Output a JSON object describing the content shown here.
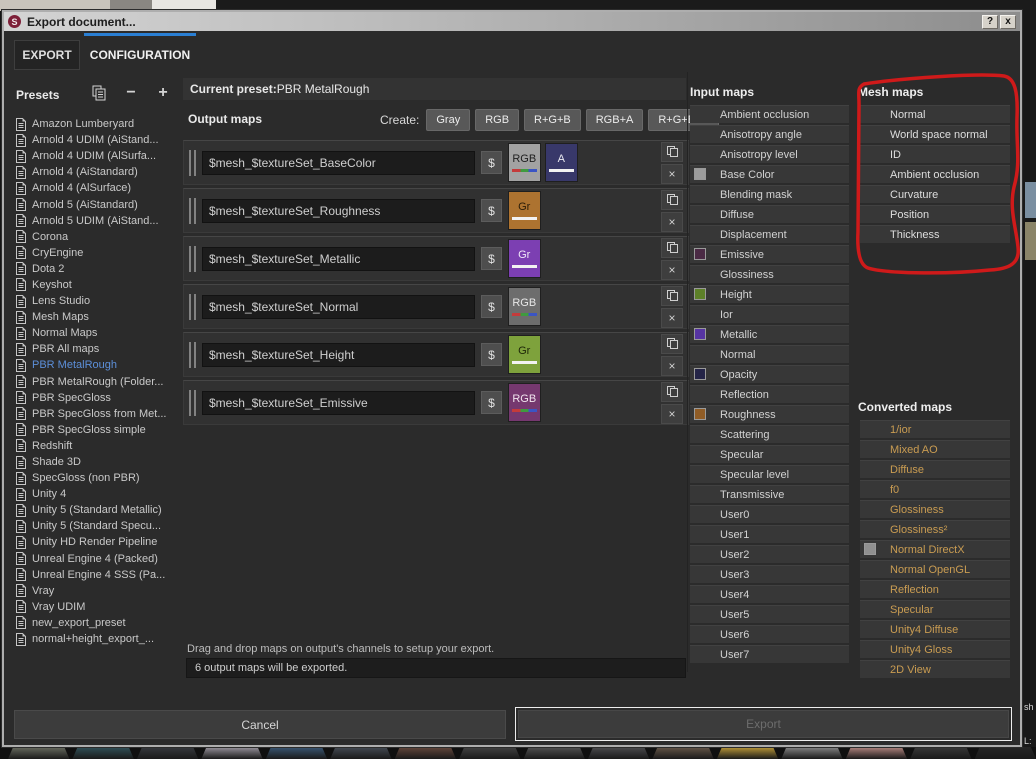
{
  "window": {
    "title": "Export document...",
    "help_label": "?",
    "close_label": "x"
  },
  "tabs": {
    "export": "EXPORT",
    "configuration": "CONFIGURATION"
  },
  "presets": {
    "title": "Presets",
    "selected": "PBR MetalRough",
    "items": [
      "Amazon Lumberyard",
      "Arnold 4 UDIM (AiStand...",
      "Arnold 4 UDIM (AlSurfa...",
      "Arnold 4 (AiStandard)",
      "Arnold 4 (AlSurface)",
      "Arnold 5 (AiStandard)",
      "Arnold 5 UDIM (AiStand...",
      "Corona",
      "CryEngine",
      "Dota 2",
      "Keyshot",
      "Lens Studio",
      "Mesh Maps",
      "Normal Maps",
      "PBR All maps",
      "PBR MetalRough",
      "PBR MetalRough (Folder...",
      "PBR SpecGloss",
      "PBR SpecGloss from Met...",
      "PBR SpecGloss simple",
      "Redshift",
      "Shade 3D",
      "SpecGloss (non PBR)",
      "Unity 4",
      "Unity 5 (Standard Metallic)",
      "Unity 5 (Standard Specu...",
      "Unity HD Render Pipeline",
      "Unreal Engine 4 (Packed)",
      "Unreal Engine 4 SSS (Pa...",
      "Vray",
      "Vray UDIM",
      "new_export_preset",
      "normal+height_export_..."
    ]
  },
  "current_preset": {
    "label": "Current preset:",
    "value": "PBR MetalRough"
  },
  "output_maps": {
    "title": "Output maps",
    "create_label": "Create:",
    "create_buttons": [
      "Gray",
      "RGB",
      "R+G+B",
      "RGB+A",
      "R+G+B+A"
    ],
    "dollar_label": "$",
    "remove_label": "×",
    "rows": [
      {
        "name": "$mesh_$textureSet_BaseColor",
        "chips": [
          {
            "label": "RGB",
            "bg": "#a2a2a2",
            "fg": "#1e1e1e",
            "line": "rgb"
          },
          {
            "label": "A",
            "bg": "#38386a",
            "fg": "#e8e8f0",
            "line": "white"
          }
        ]
      },
      {
        "name": "$mesh_$textureSet_Roughness",
        "chips": [
          {
            "label": "Gr",
            "bg": "#ad7330",
            "fg": "#2a1c08",
            "line": "white"
          }
        ]
      },
      {
        "name": "$mesh_$textureSet_Metallic",
        "chips": [
          {
            "label": "Gr",
            "bg": "#7c3fb2",
            "fg": "#f0e8f8",
            "line": "white"
          }
        ]
      },
      {
        "name": "$mesh_$textureSet_Normal",
        "chips": [
          {
            "label": "RGB",
            "bg": "#6d6d6d",
            "fg": "#e8e8e8",
            "line": "rgb"
          }
        ]
      },
      {
        "name": "$mesh_$textureSet_Height",
        "chips": [
          {
            "label": "Gr",
            "bg": "#7ea23c",
            "fg": "#1d2608",
            "line": "white"
          }
        ]
      },
      {
        "name": "$mesh_$textureSet_Emissive",
        "chips": [
          {
            "label": "RGB",
            "bg": "#75386f",
            "fg": "#f0e4ee",
            "line": "rgb"
          }
        ]
      }
    ],
    "hint": "Drag and drop maps on output's channels to setup your export.",
    "status": "6 output maps will be exported."
  },
  "input_maps": {
    "title": "Input maps",
    "items": [
      {
        "label": "Ambient occlusion"
      },
      {
        "label": "Anisotropy angle"
      },
      {
        "label": "Anisotropy level"
      },
      {
        "label": "Base Color",
        "swatch": "#9c9c9c"
      },
      {
        "label": "Blending mask"
      },
      {
        "label": "Diffuse"
      },
      {
        "label": "Displacement"
      },
      {
        "label": "Emissive",
        "swatch": "#4a2a44"
      },
      {
        "label": "Glossiness"
      },
      {
        "label": "Height",
        "swatch": "#5d8029"
      },
      {
        "label": "Ior"
      },
      {
        "label": "Metallic",
        "swatch": "#5634a2"
      },
      {
        "label": "Normal"
      },
      {
        "label": "Opacity",
        "swatch": "#242447"
      },
      {
        "label": "Reflection"
      },
      {
        "label": "Roughness",
        "swatch": "#8f5c26"
      },
      {
        "label": "Scattering"
      },
      {
        "label": "Specular"
      },
      {
        "label": "Specular level"
      },
      {
        "label": "Transmissive"
      },
      {
        "label": "User0"
      },
      {
        "label": "User1"
      },
      {
        "label": "User2"
      },
      {
        "label": "User3"
      },
      {
        "label": "User4"
      },
      {
        "label": "User5"
      },
      {
        "label": "User6"
      },
      {
        "label": "User7"
      }
    ]
  },
  "mesh_maps": {
    "title": "Mesh maps",
    "items": [
      {
        "label": "Normal"
      },
      {
        "label": "World space normal"
      },
      {
        "label": "ID"
      },
      {
        "label": "Ambient occlusion"
      },
      {
        "label": "Curvature"
      },
      {
        "label": "Position"
      },
      {
        "label": "Thickness"
      }
    ]
  },
  "converted_maps": {
    "title": "Converted maps",
    "items": [
      {
        "label": "1/ior"
      },
      {
        "label": "Mixed AO"
      },
      {
        "label": "Diffuse"
      },
      {
        "label": "f0"
      },
      {
        "label": "Glossiness"
      },
      {
        "label": "Glossiness²"
      },
      {
        "label": "Normal DirectX",
        "swatch": "#909090"
      },
      {
        "label": "Normal OpenGL"
      },
      {
        "label": "Reflection"
      },
      {
        "label": "Specular"
      },
      {
        "label": "Unity4 Diffuse"
      },
      {
        "label": "Unity4 Gloss"
      },
      {
        "label": "2D View"
      }
    ]
  },
  "footer": {
    "cancel_label": "Cancel",
    "export_label": "Export"
  },
  "background": {
    "fragments": [
      "sh",
      "L:"
    ],
    "thumbnails": [
      "#6e7265",
      "#33565e",
      "#383b40",
      "#a39ea8",
      "#3c5c7c",
      "#474e58",
      "#6a4a3e",
      "#454545",
      "#565656",
      "#4f4f52",
      "#6b5b4b",
      "#caa43a",
      "#8e8e8e",
      "#c08f88",
      "#3a3a3a",
      "#262626"
    ]
  },
  "colors": {
    "tab_accent": "#2a7fd4",
    "selected_preset": "#5c8fd9",
    "annotation_red": "#cf1a1a",
    "converted_text": "#c99c52"
  }
}
